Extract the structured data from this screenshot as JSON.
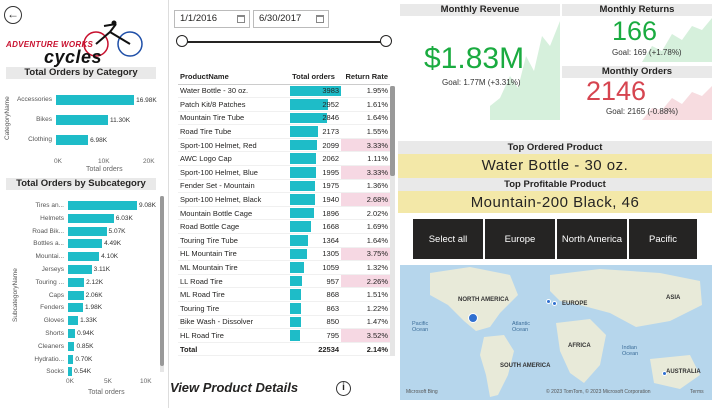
{
  "nav": {
    "back_icon": "arrow-left-icon"
  },
  "logo": {
    "line1": "ADVENTURE WORKS",
    "line2": "cycles"
  },
  "category_chart": {
    "title": "Total Orders by Category",
    "ylabel": "CategoryName",
    "xlabel": "Total orders",
    "ticks": [
      "0K",
      "10K",
      "20K"
    ],
    "categories": [
      "Accessories",
      "Bikes",
      "Clothing"
    ],
    "value_labels": [
      "16.98K",
      "11.30K",
      "6.98K"
    ],
    "values": [
      16980,
      11300,
      6980
    ],
    "xlim": [
      0,
      20000
    ]
  },
  "subcategory_chart": {
    "title": "Total Orders by Subcategory",
    "ylabel": "SubcategoryName",
    "xlabel": "Total orders",
    "ticks": [
      "0K",
      "5K",
      "10K"
    ],
    "categories": [
      "Tires an...",
      "Helmets",
      "Road Bik...",
      "Bottles a...",
      "Mountai...",
      "Jerseys",
      "Touring ...",
      "Caps",
      "Fenders",
      "Gloves",
      "Shorts",
      "Cleaners",
      "Hydratio...",
      "Socks"
    ],
    "value_labels": [
      "9.08K",
      "6.03K",
      "5.07K",
      "4.49K",
      "4.10K",
      "3.11K",
      "2.12K",
      "2.06K",
      "1.98K",
      "1.33K",
      "0.94K",
      "0.85K",
      "0.70K",
      "0.54K"
    ],
    "values": [
      9080,
      6030,
      5070,
      4490,
      4100,
      3110,
      2120,
      2060,
      1980,
      1330,
      940,
      850,
      700,
      540
    ],
    "xlim": [
      0,
      10000
    ]
  },
  "date_filter": {
    "start": "1/1/2016",
    "end": "6/30/2017"
  },
  "product_table": {
    "headers": [
      "ProductName",
      "Total orders",
      "Return Rate"
    ],
    "rows": [
      [
        "Water Bottle - 30 oz.",
        "3983",
        "1.95%"
      ],
      [
        "Patch Kit/8 Patches",
        "2952",
        "1.61%"
      ],
      [
        "Mountain Tire Tube",
        "2846",
        "1.64%"
      ],
      [
        "Road Tire Tube",
        "2173",
        "1.55%"
      ],
      [
        "Sport-100 Helmet, Red",
        "2099",
        "3.33%"
      ],
      [
        "AWC Logo Cap",
        "2062",
        "1.11%"
      ],
      [
        "Sport-100 Helmet, Blue",
        "1995",
        "3.33%"
      ],
      [
        "Fender Set - Mountain",
        "1975",
        "1.36%"
      ],
      [
        "Sport-100 Helmet, Black",
        "1940",
        "2.68%"
      ],
      [
        "Mountain Bottle Cage",
        "1896",
        "2.02%"
      ],
      [
        "Road Bottle Cage",
        "1668",
        "1.69%"
      ],
      [
        "Touring Tire Tube",
        "1364",
        "1.64%"
      ],
      [
        "HL Mountain Tire",
        "1305",
        "3.75%"
      ],
      [
        "ML Mountain Tire",
        "1059",
        "1.32%"
      ],
      [
        "LL Road Tire",
        "957",
        "2.26%"
      ],
      [
        "ML Road Tire",
        "868",
        "1.51%"
      ],
      [
        "Touring Tire",
        "863",
        "1.22%"
      ],
      [
        "Bike Wash - Dissolver",
        "850",
        "1.47%"
      ],
      [
        "HL Road Tire",
        "795",
        "3.52%"
      ]
    ],
    "max_orders": 3983,
    "total": {
      "label": "Total",
      "orders": "22534",
      "rate": "2.14%"
    }
  },
  "view_details": {
    "label": "View Product Details",
    "icon": "info-icon"
  },
  "kpi_revenue": {
    "title": "Monthly Revenue",
    "value": "$1.83M",
    "goal": "Goal: 1.77M (+3.31%)",
    "color": "#1aab40"
  },
  "kpi_returns": {
    "title": "Monthly Returns",
    "value": "166",
    "goal": "Goal: 169 (+1.78%)",
    "color": "#1aab40"
  },
  "kpi_orders": {
    "title": "Monthly Orders",
    "value": "2146",
    "goal": "Goal: 2165 (-0.88%)",
    "color": "#d64550"
  },
  "top_ordered": {
    "title": "Top Ordered Product",
    "value": "Water Bottle - 30 oz."
  },
  "top_profitable": {
    "title": "Top Profitable Product",
    "value": "Mountain-200 Black, 46"
  },
  "regions": [
    "Select all",
    "Europe",
    "North America",
    "Pacific"
  ],
  "map": {
    "labels": [
      "NORTH AMERICA",
      "EUROPE",
      "ASIA",
      "AFRICA",
      "SOUTH AMERICA",
      "AUSTRALIA"
    ],
    "oceans": [
      "Pacific Ocean",
      "Atlantic Ocean",
      "Indian Ocean"
    ],
    "attribution": "© 2023 TomTom, © 2023 Microsoft Corporation",
    "terms": "Terms",
    "brand": "Microsoft Bing"
  }
}
